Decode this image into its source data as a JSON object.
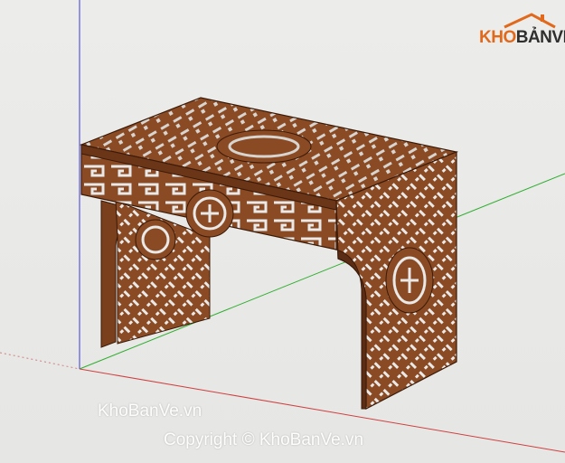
{
  "logo": {
    "part1": "KHO",
    "part2": "BẢNVẼ"
  },
  "watermark": {
    "line1": "KhoBanVe.vn",
    "line2": "Copyright © KhoBanVe.vn"
  },
  "colors": {
    "wood": "#8a4a24",
    "wood_dark": "#5a2d14",
    "wood_light": "#a35c2f",
    "axis_red": "#d04040",
    "axis_green": "#2fae2f",
    "axis_blue": "#3a3ad6",
    "brand_orange": "#e1691c"
  }
}
